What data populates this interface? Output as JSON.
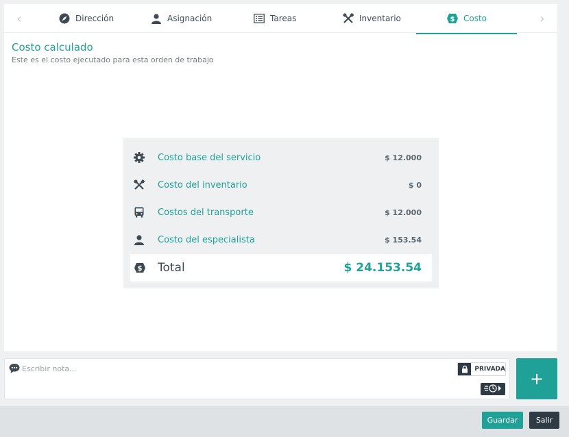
{
  "tabs": [
    {
      "label": "Dirección",
      "icon": "compass-icon"
    },
    {
      "label": "Asignación",
      "icon": "person-icon"
    },
    {
      "label": "Tareas",
      "icon": "task-list-icon"
    },
    {
      "label": "Inventario",
      "icon": "tools-icon"
    },
    {
      "label": "Costo",
      "icon": "dollar-tag-icon",
      "active": true
    }
  ],
  "nav": {
    "prev_icon": "chevron-left-icon",
    "next_icon": "chevron-right-icon"
  },
  "header": {
    "title": "Costo calculado",
    "subtitle": "Este es el costo ejecutado para esta orden de trabajo"
  },
  "costs": {
    "rows": [
      {
        "label": "Costo base del servicio",
        "value": "$ 12.000",
        "icon": "gear-icon"
      },
      {
        "label": "Costo del inventario",
        "value": "$ 0",
        "icon": "tools-icon"
      },
      {
        "label": "Costos del transporte",
        "value": "$ 12.000",
        "icon": "bus-icon"
      },
      {
        "label": "Costo del especialista",
        "value": "$ 153.54",
        "icon": "person-icon"
      }
    ],
    "total": {
      "label": "Total",
      "value": "$ 24.153.54",
      "icon": "dollar-tag-icon"
    }
  },
  "note": {
    "placeholder": "Escribir nota...",
    "private_label": "PRIVADA",
    "icon": "speech-bubble-icon"
  },
  "actions": {
    "add_label": "+",
    "save_label": "Guardar",
    "exit_label": "Salir"
  },
  "colors": {
    "accent": "#1fa197",
    "dark": "#2f3b44",
    "text": "#3f4a52"
  }
}
